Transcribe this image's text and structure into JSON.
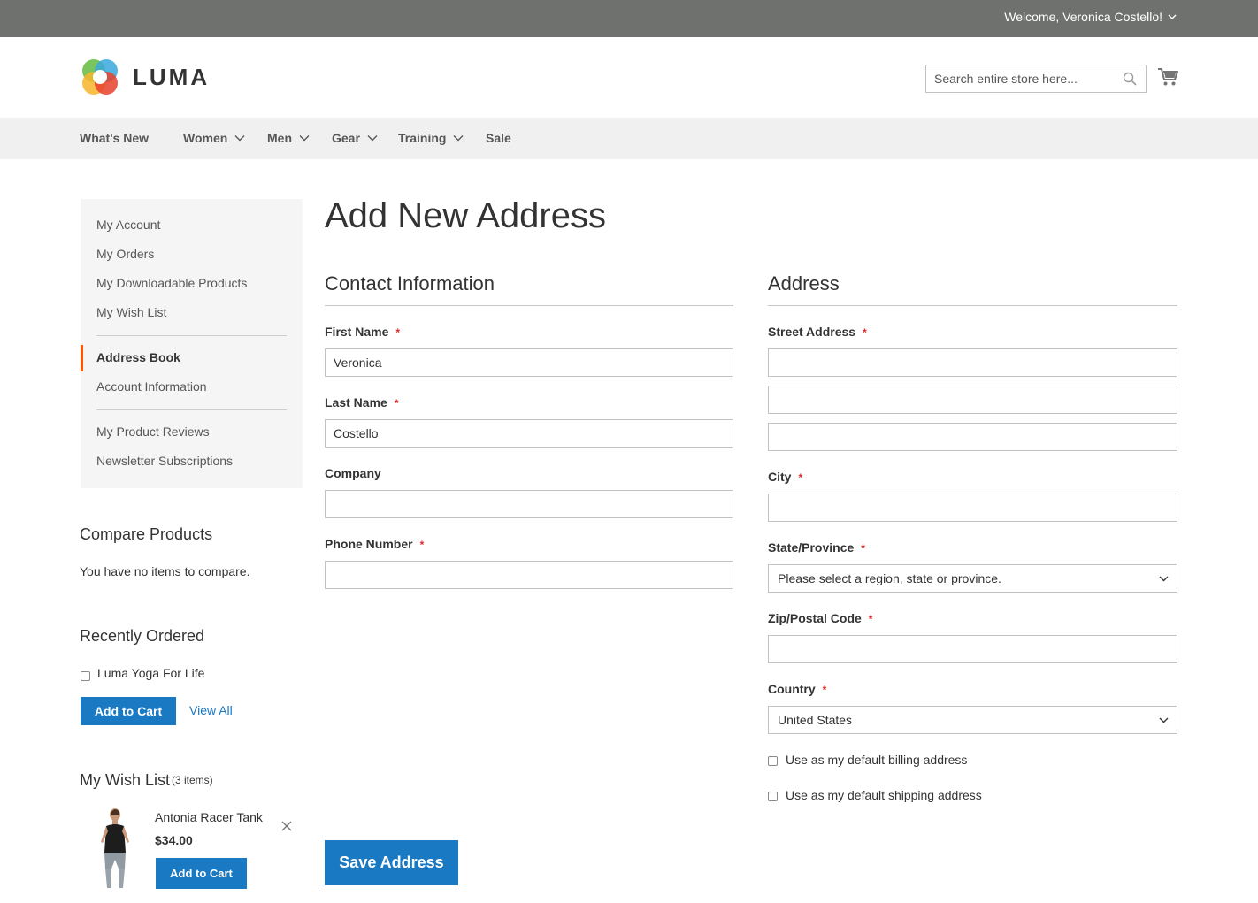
{
  "header": {
    "welcome": "Welcome, Veronica Costello!",
    "logo_text": "LUMA",
    "search_placeholder": "Search entire store here...",
    "icons": [
      "search-icon",
      "cart-icon",
      "chevron-down-icon"
    ]
  },
  "nav": {
    "items": [
      {
        "label": "What's New",
        "has_dropdown": false
      },
      {
        "label": "Women",
        "has_dropdown": true
      },
      {
        "label": "Men",
        "has_dropdown": true
      },
      {
        "label": "Gear",
        "has_dropdown": true
      },
      {
        "label": "Training",
        "has_dropdown": true
      },
      {
        "label": "Sale",
        "has_dropdown": false
      }
    ]
  },
  "sidebar": {
    "items": [
      {
        "label": "My Account"
      },
      {
        "label": "My Orders"
      },
      {
        "label": "My Downloadable Products"
      },
      {
        "label": "My Wish List"
      },
      {
        "label": "Address Book",
        "current": true
      },
      {
        "label": "Account Information"
      },
      {
        "label": "My Product Reviews"
      },
      {
        "label": "Newsletter Subscriptions"
      }
    ],
    "accent_color": "#ff5501"
  },
  "compare": {
    "title": "Compare Products",
    "empty_text": "You have no items to compare."
  },
  "recently_ordered": {
    "title": "Recently Ordered",
    "item": "Luma Yoga For Life",
    "add_to_cart": "Add to Cart",
    "view_all": "View All"
  },
  "wishlist": {
    "title": "My Wish List",
    "count": "(3 items)",
    "item_name": "Antonia Racer Tank",
    "item_price": "$34.00",
    "add_to_cart": "Add to Cart"
  },
  "main": {
    "title": "Add New Address",
    "contact": {
      "legend": "Contact Information",
      "first_name_label": "First Name",
      "first_name_value": "Veronica",
      "last_name_label": "Last Name",
      "last_name_value": "Costello",
      "company_label": "Company",
      "company_value": "",
      "phone_label": "Phone Number",
      "phone_value": ""
    },
    "address": {
      "legend": "Address",
      "street_label": "Street Address",
      "street_values": [
        "",
        "",
        ""
      ],
      "city_label": "City",
      "city_value": "",
      "state_label": "State/Province",
      "state_value": "Please select a region, state or province.",
      "zip_label": "Zip/Postal Code",
      "zip_value": "",
      "country_label": "Country",
      "country_value": "United States",
      "default_billing": "Use as my default billing address",
      "default_shipping": "Use as my default shipping address"
    },
    "save_button": "Save Address",
    "required_mark": "*"
  },
  "colors": {
    "topbar": "#6e716e",
    "nav_bg": "#f0f0f0",
    "primary": "#1979c3",
    "required": "#e02b27"
  }
}
